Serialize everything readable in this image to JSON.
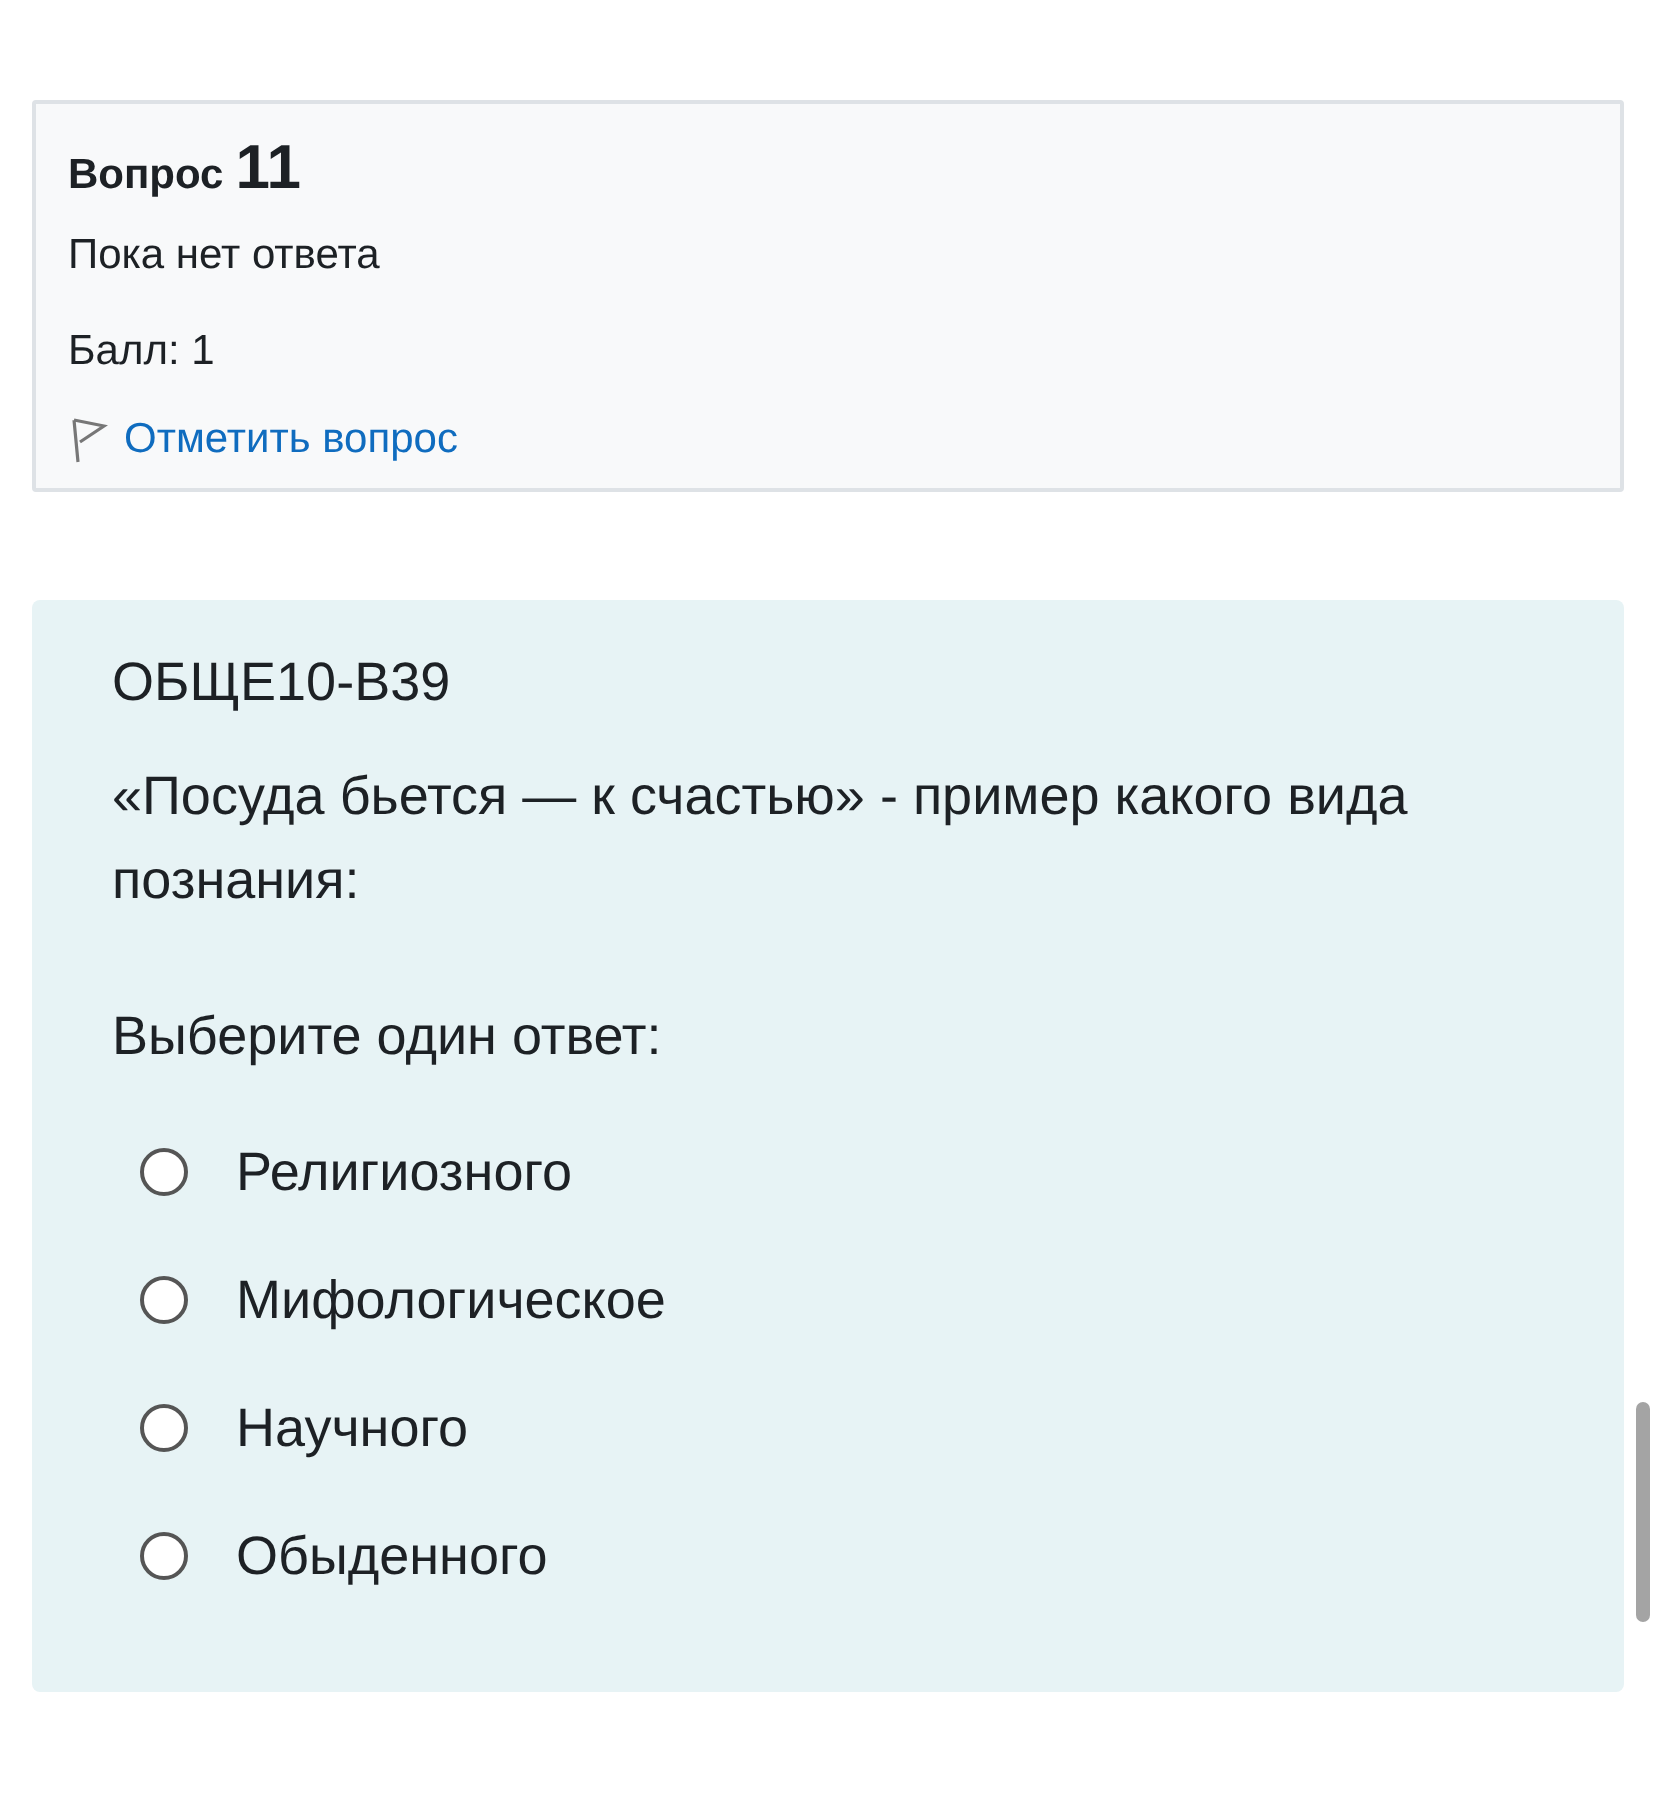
{
  "question_info": {
    "label": "Вопрос",
    "number": "11",
    "status": "Пока нет ответа",
    "grade": "Балл: 1",
    "flag_link": "Отметить вопрос"
  },
  "question": {
    "code": "ОБЩЕ10-В39",
    "text": "«Посуда бьется — к счастью» - пример какого вида познания:",
    "prompt": "Выберите один ответ:",
    "options": [
      {
        "label": "Религиозного",
        "selected": false
      },
      {
        "label": "Мифологическое",
        "selected": false
      },
      {
        "label": "Научного",
        "selected": false
      },
      {
        "label": "Обыденного",
        "selected": false
      }
    ]
  }
}
